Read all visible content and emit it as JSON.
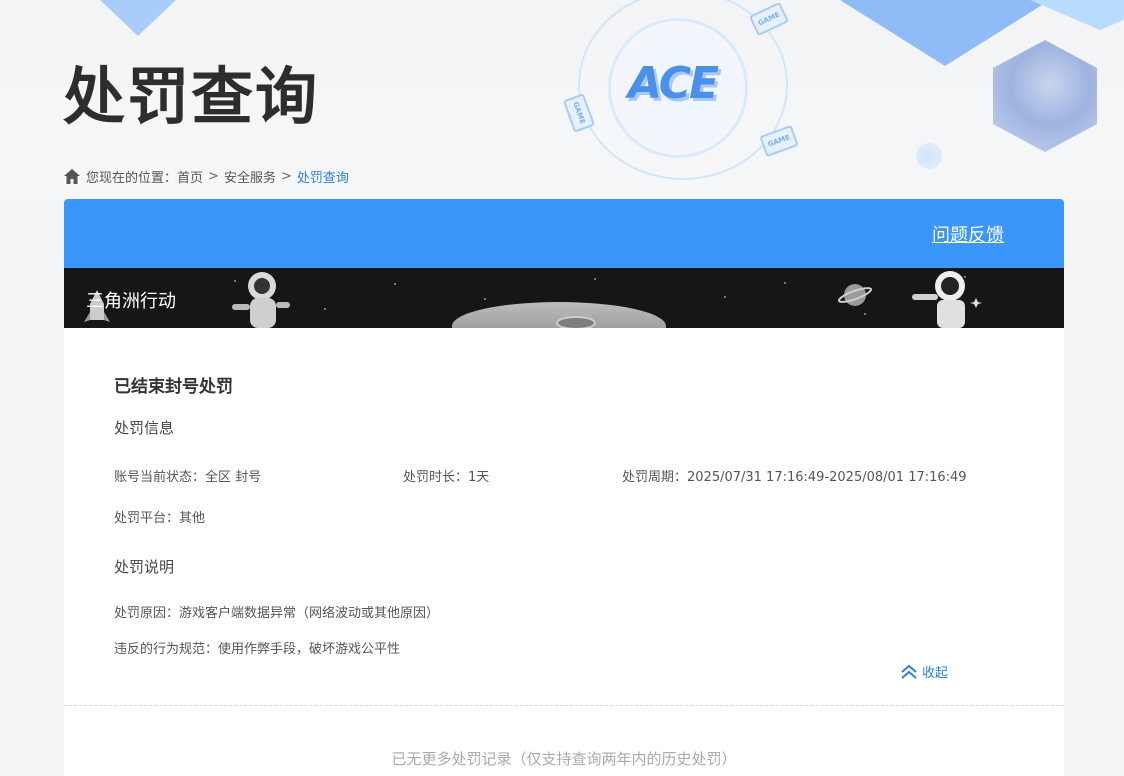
{
  "page": {
    "title": "处罚查询"
  },
  "breadcrumb": {
    "prefix": "您现在的位置：",
    "items": [
      "首页",
      "安全服务",
      "处罚查询"
    ],
    "separator": ">"
  },
  "header_decor": {
    "logo_text": "ACE",
    "game_tag": "GAME"
  },
  "card": {
    "feedback_label": "问题反馈",
    "game_name": "三角洲行动",
    "accent_color": "#3a96fb"
  },
  "punishment": {
    "title": "已结束封号处罚",
    "info_heading": "处罚信息",
    "status": "账号当前状态：全区 封号",
    "duration": "处罚时长：1天",
    "period": "处罚周期：2025/07/31 17:16:49-2025/08/01 17:16:49",
    "platform": "处罚平台：其他",
    "desc_heading": "处罚说明",
    "reason": "处罚原因：游戏客户端数据异常（网络波动或其他原因）",
    "violation": "违反的行为规范：使用作弊手段，破坏游戏公平性",
    "collapse_label": "收起"
  },
  "footer": {
    "note": "已无更多处罚记录（仅支持查询两年内的历史处罚）"
  }
}
